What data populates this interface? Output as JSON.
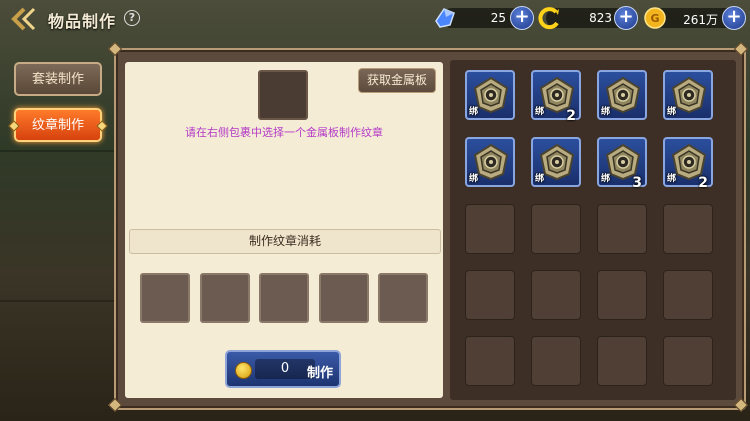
{
  "header": {
    "title": "物品制作",
    "help_glyph": "?"
  },
  "currencies": [
    {
      "icon": "blue-crystal-icon",
      "value": "25"
    },
    {
      "icon": "yellow-swirl-icon",
      "value": "823"
    },
    {
      "icon": "gold-coin-icon",
      "value": "261万"
    }
  ],
  "tabs": [
    {
      "label": "套装制作",
      "active": false
    },
    {
      "label": "纹章制作",
      "active": true
    }
  ],
  "craft": {
    "get_plate_label": "获取金属板",
    "hint": "请在右侧包裹中选择一个金属板制作纹章",
    "cost_title": "制作纹章消耗",
    "make_cost": "0",
    "make_label": "制作"
  },
  "inventory": {
    "bind_label": "绑",
    "items": [
      {
        "icon": "metal-plate-icon",
        "bound": true,
        "count": ""
      },
      {
        "icon": "metal-plate-icon",
        "bound": true,
        "count": "2"
      },
      {
        "icon": "metal-plate-icon",
        "bound": true,
        "count": ""
      },
      {
        "icon": "metal-plate-icon",
        "bound": true,
        "count": ""
      },
      {
        "icon": "metal-plate-icon",
        "bound": true,
        "count": ""
      },
      {
        "icon": "metal-plate-icon",
        "bound": true,
        "count": ""
      },
      {
        "icon": "metal-plate-icon",
        "bound": true,
        "count": "3"
      },
      {
        "icon": "metal-plate-icon",
        "bound": true,
        "count": "2"
      }
    ]
  },
  "colors": {
    "accent_orange": "#e5561a",
    "slot_blue": "#223d86",
    "panel_cream": "#f5ecd6",
    "hint_purple": "#b43ac7"
  }
}
